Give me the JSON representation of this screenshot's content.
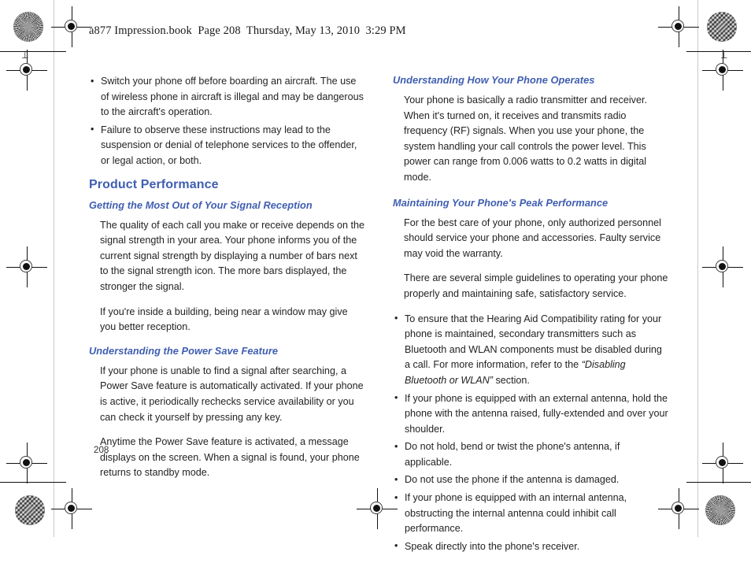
{
  "document": {
    "book_header": "a877 Impression.book  Page 208  Thursday, May 13, 2010  3:29 PM",
    "folio": "208"
  },
  "left_column": {
    "top_bullets": [
      "Switch your phone off before boarding an aircraft. The use of wireless phone in aircraft is illegal and may be dangerous to the aircraft's operation.",
      "Failure to observe these instructions may lead to the suspension or denial of telephone services to the offender, or legal action, or both."
    ],
    "chapter_heading": "Product Performance",
    "sections": [
      {
        "heading": "Getting the Most Out of Your Signal Reception",
        "paragraphs": [
          "The quality of each call you make or receive depends on the signal strength in your area. Your phone informs you of the current signal strength by displaying a number of bars next to the signal strength icon. The more bars displayed, the stronger the signal.",
          "If you're inside a building, being near a window may give you better reception."
        ]
      },
      {
        "heading": "Understanding the Power Save Feature",
        "paragraphs": [
          "If your phone is unable to find a signal after searching, a Power Save feature is automatically activated. If your phone is active, it periodically rechecks service availability or you can check it yourself by pressing any key.",
          "Anytime the Power Save feature is activated, a message displays on the screen. When a signal is found, your phone returns to standby mode."
        ]
      }
    ]
  },
  "right_column": {
    "sections": [
      {
        "heading": "Understanding How Your Phone Operates",
        "paragraphs": [
          "Your phone is basically a radio transmitter and receiver. When it's turned on, it receives and transmits radio frequency (RF) signals. When you use your phone, the system handling your call controls the power level. This power can range from 0.006 watts to 0.2 watts in digital mode."
        ]
      },
      {
        "heading": "Maintaining Your Phone's Peak Performance",
        "paragraphs": [
          "For the best care of your phone, only authorized personnel should service your phone and accessories. Faulty service may void the warranty.",
          "There are several simple guidelines to operating your phone properly and maintaining safe, satisfactory service."
        ]
      }
    ],
    "bullets": [
      {
        "pre": "To ensure that the Hearing Aid Compatibility rating for your phone is maintained, secondary transmitters such as Bluetooth and WLAN components must be disabled during a call. For more information, refer to the ",
        "italic": "“Disabling Bluetooth or WLAN”",
        "post": " section."
      },
      {
        "pre": "If your phone is equipped with an external antenna, hold the phone with the antenna raised, fully-extended and over your shoulder.",
        "italic": "",
        "post": ""
      },
      {
        "pre": "Do not hold, bend or twist the phone's antenna, if applicable.",
        "italic": "",
        "post": ""
      },
      {
        "pre": "Do not use the phone if the antenna is damaged.",
        "italic": "",
        "post": ""
      },
      {
        "pre": "If your phone is equipped with an internal antenna, obstructing the internal antenna could inhibit call performance.",
        "italic": "",
        "post": ""
      },
      {
        "pre": "Speak directly into the phone's receiver.",
        "italic": "",
        "post": ""
      }
    ]
  },
  "theme": {
    "heading_color": "#3f5eb0",
    "body_color": "#232323",
    "page_background": "#ffffff"
  }
}
